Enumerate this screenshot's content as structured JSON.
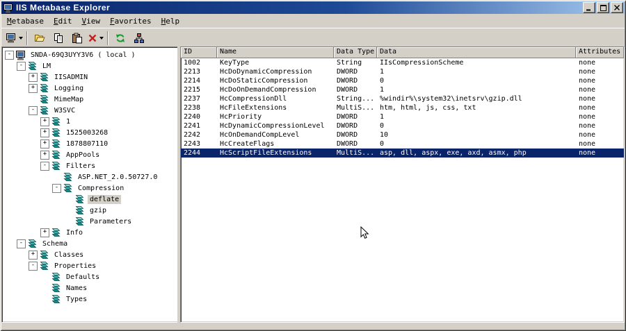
{
  "window": {
    "title": "IIS Metabase Explorer",
    "icon": "computer-icon",
    "controls": [
      {
        "name": "minimize",
        "icon": "minimize-icon"
      },
      {
        "name": "maximize",
        "icon": "maximize-icon"
      },
      {
        "name": "close",
        "icon": "close-icon"
      }
    ]
  },
  "menu": {
    "items": [
      {
        "accel": "M",
        "rest": "etabase"
      },
      {
        "accel": "E",
        "rest": "dit"
      },
      {
        "accel": "V",
        "rest": "iew"
      },
      {
        "accel": "F",
        "rest": "avorites"
      },
      {
        "accel": "H",
        "rest": "elp"
      }
    ]
  },
  "toolbar": {
    "items": [
      {
        "name": "connect",
        "icon": "computer-icon",
        "dropdown": true
      },
      {
        "separator": true
      },
      {
        "name": "open-key",
        "icon": "folder-icon"
      },
      {
        "name": "copy",
        "icon": "copy-icon"
      },
      {
        "name": "paste",
        "icon": "paste-icon"
      },
      {
        "name": "delete",
        "icon": "delete-icon",
        "dropdown": true
      },
      {
        "separator": true
      },
      {
        "name": "refresh",
        "icon": "refresh-icon"
      },
      {
        "name": "network",
        "icon": "network-icon"
      }
    ]
  },
  "tree": {
    "items": [
      {
        "label": "SNDA-69Q3UYY3V6 ( local )",
        "depth": 0,
        "expand": "-",
        "icon": "computer-icon",
        "selected": false
      },
      {
        "label": "LM",
        "depth": 1,
        "expand": "-",
        "icon": "key-icon",
        "selected": false
      },
      {
        "label": "IISADMIN",
        "depth": 2,
        "expand": "+",
        "icon": "key-icon",
        "selected": false
      },
      {
        "label": "Logging",
        "depth": 2,
        "expand": "+",
        "icon": "key-icon",
        "selected": false
      },
      {
        "label": "MimeMap",
        "depth": 2,
        "expand": "",
        "icon": "key-icon",
        "selected": false
      },
      {
        "label": "W3SVC",
        "depth": 2,
        "expand": "-",
        "icon": "key-icon",
        "selected": false
      },
      {
        "label": "1",
        "depth": 3,
        "expand": "+",
        "icon": "key-icon",
        "selected": false
      },
      {
        "label": "1525003268",
        "depth": 3,
        "expand": "+",
        "icon": "key-icon",
        "selected": false
      },
      {
        "label": "1878807110",
        "depth": 3,
        "expand": "+",
        "icon": "key-icon",
        "selected": false
      },
      {
        "label": "AppPools",
        "depth": 3,
        "expand": "+",
        "icon": "key-icon",
        "selected": false
      },
      {
        "label": "Filters",
        "depth": 3,
        "expand": "-",
        "icon": "key-icon",
        "selected": false
      },
      {
        "label": "ASP.NET_2.0.50727.0",
        "depth": 4,
        "expand": "",
        "icon": "key-icon",
        "selected": false
      },
      {
        "label": "Compression",
        "depth": 4,
        "expand": "-",
        "icon": "key-icon",
        "selected": false
      },
      {
        "label": "deflate",
        "depth": 5,
        "expand": "",
        "icon": "key-icon",
        "selected": true
      },
      {
        "label": "gzip",
        "depth": 5,
        "expand": "",
        "icon": "key-icon",
        "selected": false
      },
      {
        "label": "Parameters",
        "depth": 5,
        "expand": "",
        "icon": "key-icon",
        "selected": false
      },
      {
        "label": "Info",
        "depth": 3,
        "expand": "+",
        "icon": "key-icon",
        "selected": false
      },
      {
        "label": "Schema",
        "depth": 1,
        "expand": "-",
        "icon": "key-icon",
        "selected": false
      },
      {
        "label": "Classes",
        "depth": 2,
        "expand": "+",
        "icon": "key-icon",
        "selected": false
      },
      {
        "label": "Properties",
        "depth": 2,
        "expand": "-",
        "icon": "key-icon",
        "selected": false
      },
      {
        "label": "Defaults",
        "depth": 3,
        "expand": "",
        "icon": "key-icon",
        "selected": false
      },
      {
        "label": "Names",
        "depth": 3,
        "expand": "",
        "icon": "key-icon",
        "selected": false
      },
      {
        "label": "Types",
        "depth": 3,
        "expand": "",
        "icon": "key-icon",
        "selected": false
      }
    ]
  },
  "list": {
    "columns": [
      "ID",
      "Name",
      "Data Type",
      "Data",
      "Attributes"
    ],
    "rows": [
      {
        "cells": [
          "1002",
          "KeyType",
          "String",
          "IIsCompressionScheme",
          "none"
        ],
        "selected": false
      },
      {
        "cells": [
          "2213",
          "HcDoDynamicCompression",
          "DWORD",
          "1",
          "none"
        ],
        "selected": false
      },
      {
        "cells": [
          "2214",
          "HcDoStaticCompression",
          "DWORD",
          "0",
          "none"
        ],
        "selected": false
      },
      {
        "cells": [
          "2215",
          "HcDoOnDemandCompression",
          "DWORD",
          "1",
          "none"
        ],
        "selected": false
      },
      {
        "cells": [
          "2237",
          "HcCompressionDll",
          "String...",
          "%windir%\\system32\\inetsrv\\gzip.dll",
          "none"
        ],
        "selected": false
      },
      {
        "cells": [
          "2238",
          "HcFileExtensions",
          "MultiS...",
          "htm, html, js, css, txt",
          "none"
        ],
        "selected": false
      },
      {
        "cells": [
          "2240",
          "HcPriority",
          "DWORD",
          "1",
          "none"
        ],
        "selected": false
      },
      {
        "cells": [
          "2241",
          "HcDynamicCompressionLevel",
          "DWORD",
          "0",
          "none"
        ],
        "selected": false
      },
      {
        "cells": [
          "2242",
          "HcOnDemandCompLevel",
          "DWORD",
          "10",
          "none"
        ],
        "selected": false
      },
      {
        "cells": [
          "2243",
          "HcCreateFlags",
          "DWORD",
          "0",
          "none"
        ],
        "selected": false
      },
      {
        "cells": [
          "2244",
          "HcScriptFileExtensions",
          "MultiS...",
          "asp, dll, aspx, exe, axd, asmx, php",
          "none"
        ],
        "selected": true
      }
    ]
  },
  "colors": {
    "titlebar_gradient_start": "#0a246a",
    "titlebar_gradient_end": "#a6caf0",
    "selection": "#0a246a",
    "chrome": "#d4d0c8",
    "inactive_selection": "#d4d0c8",
    "panel_background": "#ffffff"
  }
}
